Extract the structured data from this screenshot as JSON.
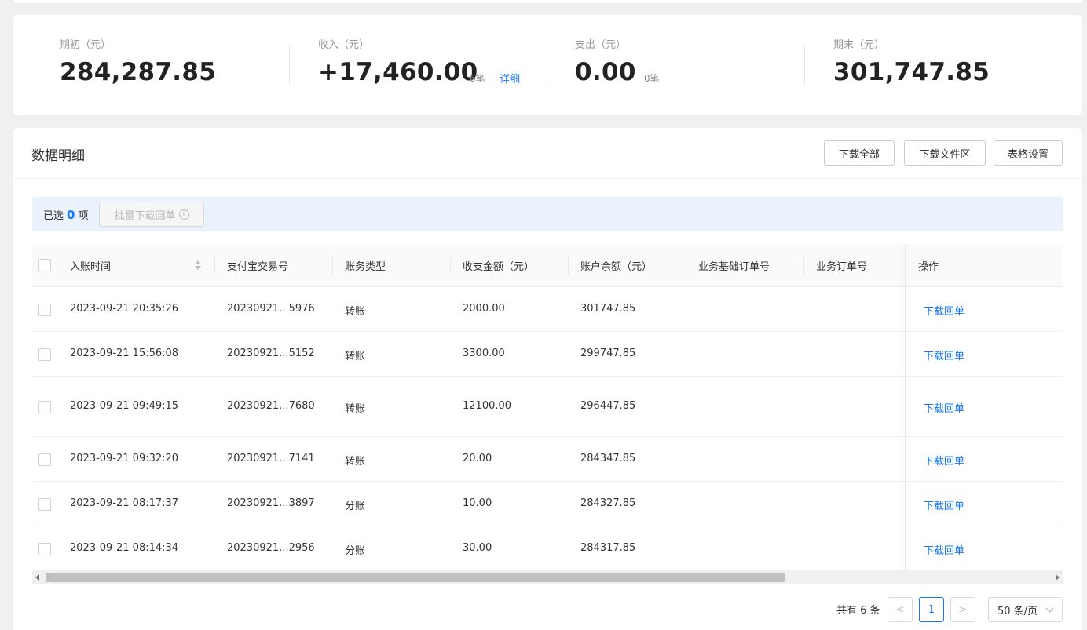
{
  "summary": {
    "opening": {
      "label": "期初（元）",
      "value": "284,287.85"
    },
    "income": {
      "label": "收入（元）",
      "value": "+17,460.00",
      "count": "6笔",
      "detail_link": "详细"
    },
    "expense": {
      "label": "支出（元）",
      "value": "0.00",
      "count": "0笔"
    },
    "closing": {
      "label": "期末（元）",
      "value": "301,747.85"
    }
  },
  "detail": {
    "title": "数据明细",
    "buttons": {
      "download_all": "下载全部",
      "download_files": "下载文件区",
      "table_settings": "表格设置"
    },
    "selection": {
      "prefix": "已选",
      "count": "0",
      "suffix": "项",
      "batch_label": "批量下载回单",
      "info_icon": "i"
    }
  },
  "table": {
    "columns": [
      "入账时间",
      "支付宝交易号",
      "账务类型",
      "收支金额（元）",
      "账户余额（元）",
      "业务基础订单号",
      "业务订单号",
      "操作"
    ],
    "rows": [
      {
        "time": "2023-09-21 20:35:26",
        "trade_no": "20230921...5976",
        "type": "转账",
        "amount": "2000.00",
        "balance": "301747.85",
        "action": "下载回单"
      },
      {
        "time": "2023-09-21 15:56:08",
        "trade_no": "20230921...5152",
        "type": "转账",
        "amount": "3300.00",
        "balance": "299747.85",
        "action": "下载回单"
      },
      {
        "time": "2023-09-21 09:49:15",
        "trade_no": "20230921...7680",
        "type": "转账",
        "amount": "12100.00",
        "balance": "296447.85",
        "action": "下载回单"
      },
      {
        "time": "2023-09-21 09:32:20",
        "trade_no": "20230921...7141",
        "type": "转账",
        "amount": "20.00",
        "balance": "284347.85",
        "action": "下载回单"
      },
      {
        "time": "2023-09-21 08:17:37",
        "trade_no": "20230921...3897",
        "type": "分账",
        "amount": "10.00",
        "balance": "284327.85",
        "action": "下载回单"
      },
      {
        "time": "2023-09-21 08:14:34",
        "trade_no": "20230921...2956",
        "type": "分账",
        "amount": "30.00",
        "balance": "284317.85",
        "action": "下载回单"
      }
    ]
  },
  "pagination": {
    "total": "共有 6 条",
    "prev": "<",
    "current": "1",
    "next": ">",
    "page_size": "50 条/页"
  },
  "colors": {
    "accent": "#1677ff",
    "selection_bg": "#eaf2fe"
  }
}
